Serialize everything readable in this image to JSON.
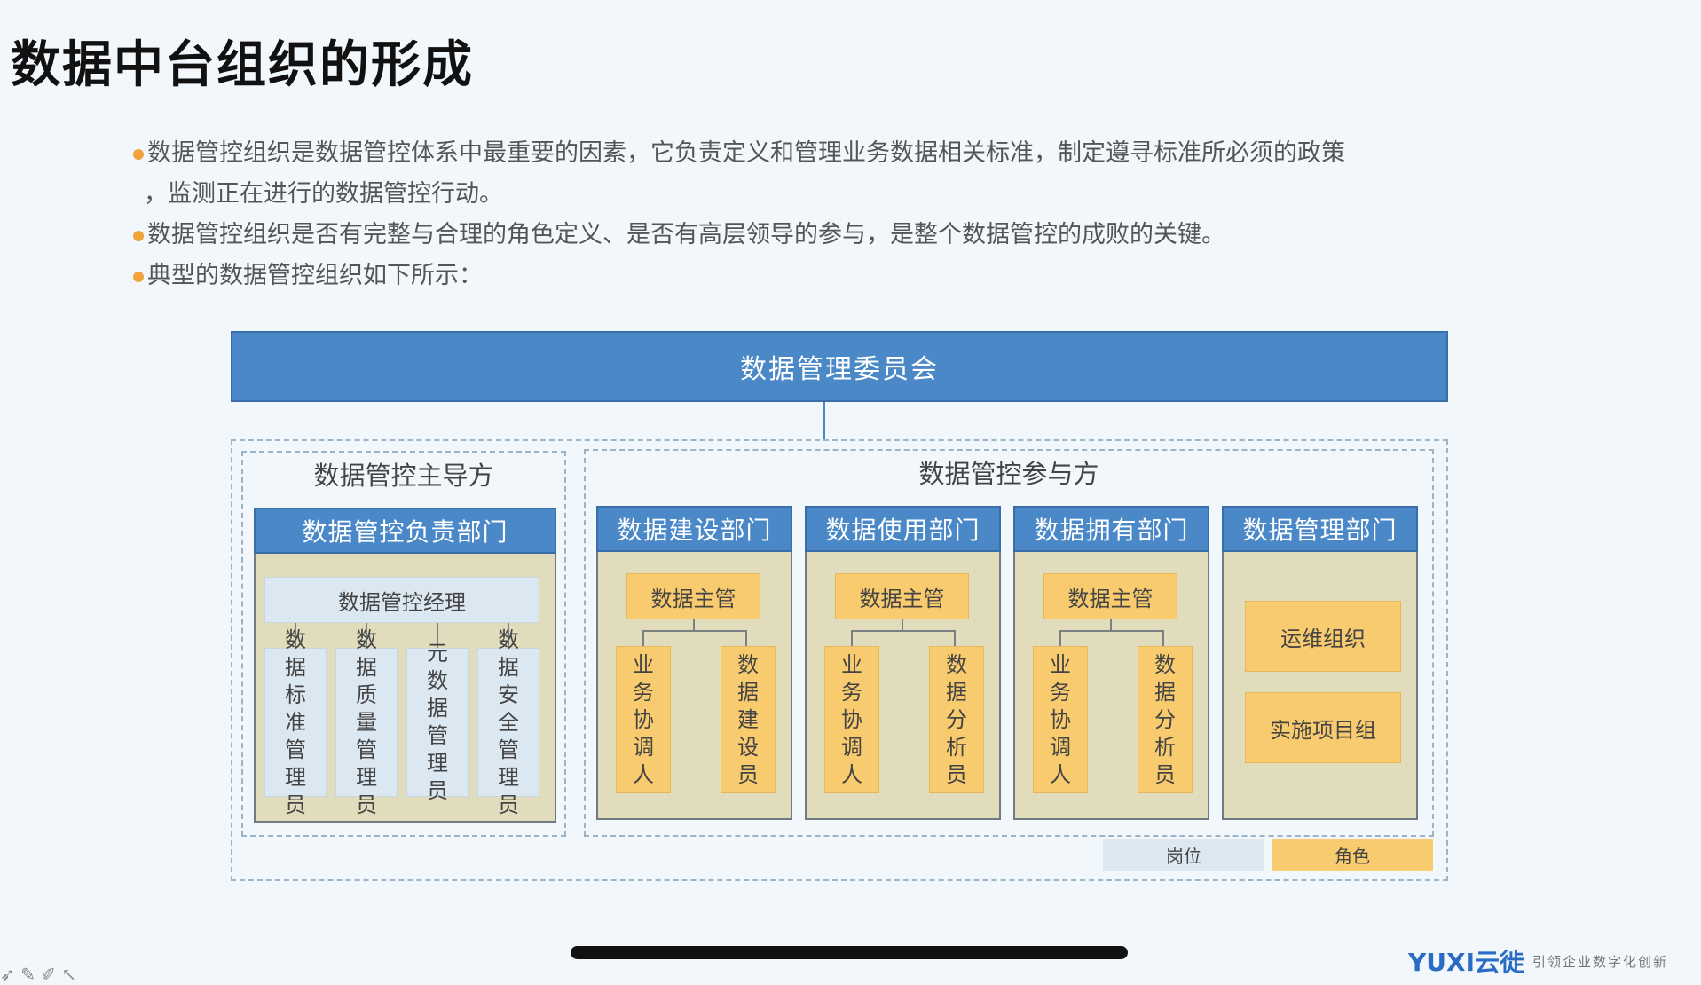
{
  "title": "数据中台组织的形成",
  "bullets": {
    "b1_line1": "数据管控组织是数据管控体系中最重要的因素，它负责定义和管理业务数据相关标准，制定遵寻标准所必须的政策",
    "b1_line2": "，监测正在进行的数据管控行动。",
    "b2": "数据管控组织是否有完整与合理的角色定义、是否有高层领导的参与，是整个数据管控的成败的关键。",
    "b3": "典型的数据管控组织如下所示："
  },
  "diagram": {
    "committee": "数据管理委员会",
    "lead_group": {
      "label": "数据管控主导方",
      "dept": "数据管控负责部门",
      "manager": "数据管控经理",
      "roles": [
        "数据标准管理员",
        "数据质量管理员",
        "元数据管理员",
        "数据安全管理员"
      ]
    },
    "participant_group": {
      "label": "数据管控参与方",
      "departments": [
        {
          "name": "数据建设部门",
          "head": "数据主管",
          "roles": [
            "业务协调人",
            "数据建设员"
          ]
        },
        {
          "name": "数据使用部门",
          "head": "数据主管",
          "roles": [
            "业务协调人",
            "数据分析员"
          ]
        },
        {
          "name": "数据拥有部门",
          "head": "数据主管",
          "roles": [
            "业务协调人",
            "数据分析员"
          ]
        },
        {
          "name": "数据管理部门",
          "items": [
            "运维组织",
            "实施项目组"
          ]
        }
      ]
    },
    "legend": {
      "post": "岗位",
      "role": "角色"
    }
  },
  "footer": {
    "logo": "YUXI云徙",
    "slogan": "引领企业数字化创新",
    "corner": "➶ ✎ ✐ ↖"
  },
  "colors": {
    "blue": "#4a88c8",
    "post": "#dbe8f2",
    "role": "#f9cb6f",
    "dept_body": "#e0dcbc",
    "bullet": "#f0a33a"
  }
}
